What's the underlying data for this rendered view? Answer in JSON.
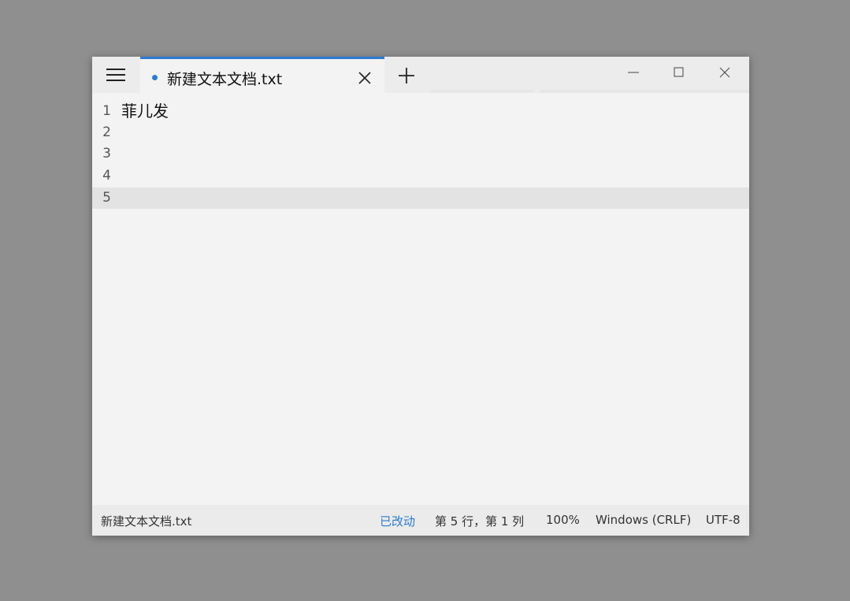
{
  "window": {
    "tab": {
      "title": "新建文本文档.txt",
      "modified_indicator": "dot-icon"
    },
    "icons": {
      "menu": "hamburger-menu-icon",
      "tab_close": "close-icon",
      "new_tab": "plus-icon",
      "minimize": "minimize-icon",
      "maximize": "maximize-icon",
      "close": "close-icon"
    }
  },
  "editor": {
    "lines": [
      {
        "number": "1",
        "text": "菲儿发"
      },
      {
        "number": "2",
        "text": ""
      },
      {
        "number": "3",
        "text": ""
      },
      {
        "number": "4",
        "text": ""
      },
      {
        "number": "5",
        "text": ""
      }
    ],
    "current_line": "5"
  },
  "statusbar": {
    "file_name": "新建文本文档.txt",
    "modified": "已改动",
    "position": "第 5 行，第 1 列",
    "zoom": "100%",
    "line_ending": "Windows (CRLF)",
    "encoding": "UTF-8"
  },
  "colors": {
    "accent": "#2b7cd3",
    "background": "#8f8f8f",
    "editor_bg": "#f3f3f3",
    "current_line_bg": "#e3e3e3"
  }
}
